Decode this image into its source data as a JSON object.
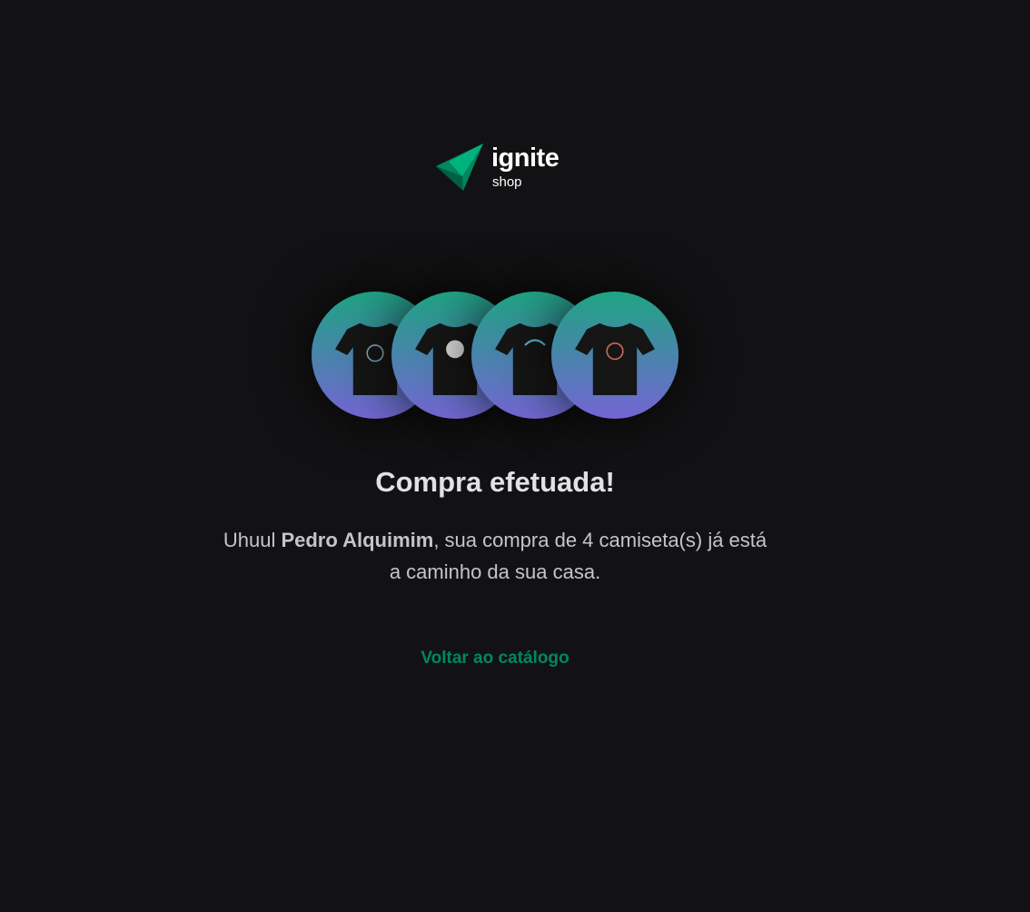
{
  "logo": {
    "word": "ignite",
    "sub": "shop"
  },
  "products": [
    {
      "name": "shirt-1-icon",
      "print_color": "#7fa7b9"
    },
    {
      "name": "shirt-2-icon",
      "print_color": "#d9d9d9"
    },
    {
      "name": "shirt-3-icon",
      "print_color": "#59b8d6"
    },
    {
      "name": "shirt-4-icon",
      "print_color": "#c46b5a"
    }
  ],
  "title": "Compra efetuada!",
  "message": {
    "prefix": "Uhuul ",
    "customer": "Pedro Alquimim",
    "suffix": ", sua compra de 4 camiseta(s) já está a caminho da sua casa."
  },
  "back_link": "Voltar ao catálogo",
  "colors": {
    "background": "#121214",
    "accent": "#00875f",
    "gradient_top": "#1ea483",
    "gradient_bottom": "#7465d4"
  }
}
